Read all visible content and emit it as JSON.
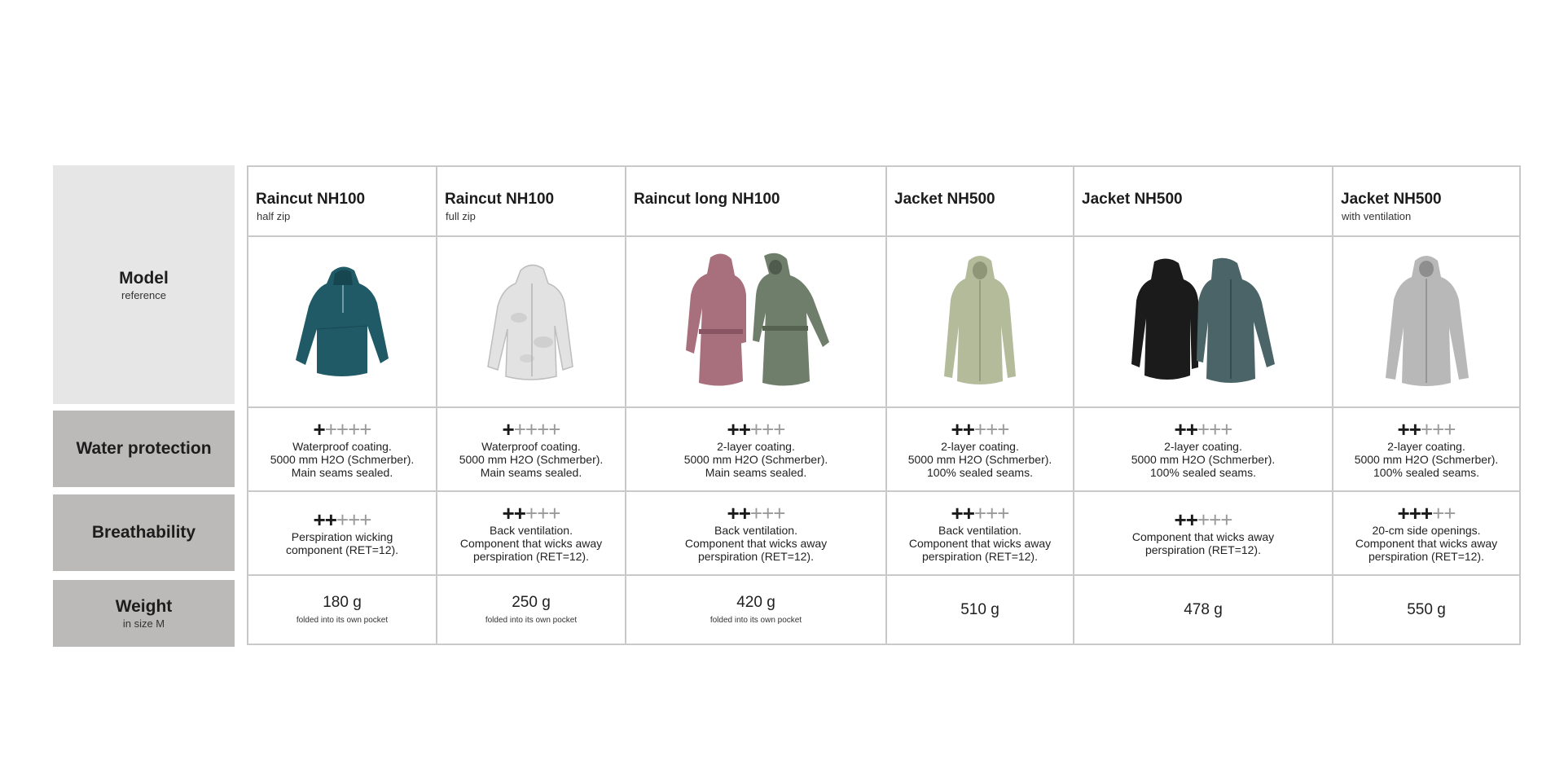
{
  "labels": {
    "model": {
      "main": "Model",
      "sub": "reference"
    },
    "water": {
      "main": "Water protection"
    },
    "breathability": {
      "main": "Breathability"
    },
    "weight": {
      "main": "Weight",
      "sub": "in size M"
    }
  },
  "products": [
    {
      "title": "Raincut NH100",
      "subtitle": "half zip",
      "image": {
        "icon": "teal-half-zip-jacket-icon",
        "colors": [
          "#1f5a66"
        ]
      },
      "water": {
        "rating": 1,
        "max": 5,
        "text": "Waterproof coating.\n5000 mm H2O (Schmerber).\nMain seams sealed."
      },
      "breathability": {
        "rating": 2,
        "max": 5,
        "text": "Perspiration wicking\ncomponent (RET=12)."
      },
      "weight": {
        "value": "180 g",
        "note": "folded into its own pocket"
      }
    },
    {
      "title": "Raincut NH100",
      "subtitle": "full zip",
      "image": {
        "icon": "white-camo-jacket-icon",
        "colors": [
          "#e2e2e2"
        ]
      },
      "water": {
        "rating": 1,
        "max": 5,
        "text": "Waterproof coating.\n5000 mm H2O (Schmerber).\nMain seams sealed."
      },
      "breathability": {
        "rating": 2,
        "max": 5,
        "text": "Back ventilation.\nComponent that wicks away\nperspiration (RET=12)."
      },
      "weight": {
        "value": "250 g",
        "note": "folded into its own pocket"
      }
    },
    {
      "title": "Raincut long NH100",
      "subtitle": "",
      "image": {
        "icon": "long-raincoats-pink-green-icon",
        "colors": [
          "#a86f7c",
          "#6f7e6b"
        ]
      },
      "water": {
        "rating": 2,
        "max": 5,
        "text": "2-layer coating.\n5000 mm H2O (Schmerber).\nMain seams sealed."
      },
      "breathability": {
        "rating": 2,
        "max": 5,
        "text": "Back ventilation.\nComponent that wicks away\nperspiration (RET=12)."
      },
      "weight": {
        "value": "420 g",
        "note": "folded into its own pocket"
      }
    },
    {
      "title": "Jacket NH500",
      "subtitle": "",
      "image": {
        "icon": "sage-jacket-icon",
        "colors": [
          "#b4bb9b"
        ]
      },
      "water": {
        "rating": 2,
        "max": 5,
        "text": "2-layer coating.\n5000 mm H2O (Schmerber).\n100% sealed seams."
      },
      "breathability": {
        "rating": 2,
        "max": 5,
        "text": "Back ventilation.\nComponent that wicks away\nperspiration (RET=12)."
      },
      "weight": {
        "value": "510 g",
        "note": ""
      }
    },
    {
      "title": "Jacket NH500",
      "subtitle": "",
      "image": {
        "icon": "black-and-teal-jackets-icon",
        "colors": [
          "#1b1b1b",
          "#4a6467"
        ]
      },
      "water": {
        "rating": 2,
        "max": 5,
        "text": "2-layer coating.\n5000 mm H2O (Schmerber).\n100% sealed seams."
      },
      "breathability": {
        "rating": 2,
        "max": 5,
        "text": "Component that wicks away\nperspiration (RET=12)."
      },
      "weight": {
        "value": "478 g",
        "note": ""
      }
    },
    {
      "title": "Jacket NH500",
      "subtitle": "with ventilation",
      "image": {
        "icon": "grey-ventilated-jacket-icon",
        "colors": [
          "#b8b8b8"
        ]
      },
      "water": {
        "rating": 2,
        "max": 5,
        "text": "2-layer coating.\n5000 mm H2O (Schmerber).\n100% sealed seams."
      },
      "breathability": {
        "rating": 3,
        "max": 5,
        "text": "20-cm side openings.\nComponent that wicks away\nperspiration (RET=12)."
      },
      "weight": {
        "value": "550 g",
        "note": ""
      }
    }
  ]
}
